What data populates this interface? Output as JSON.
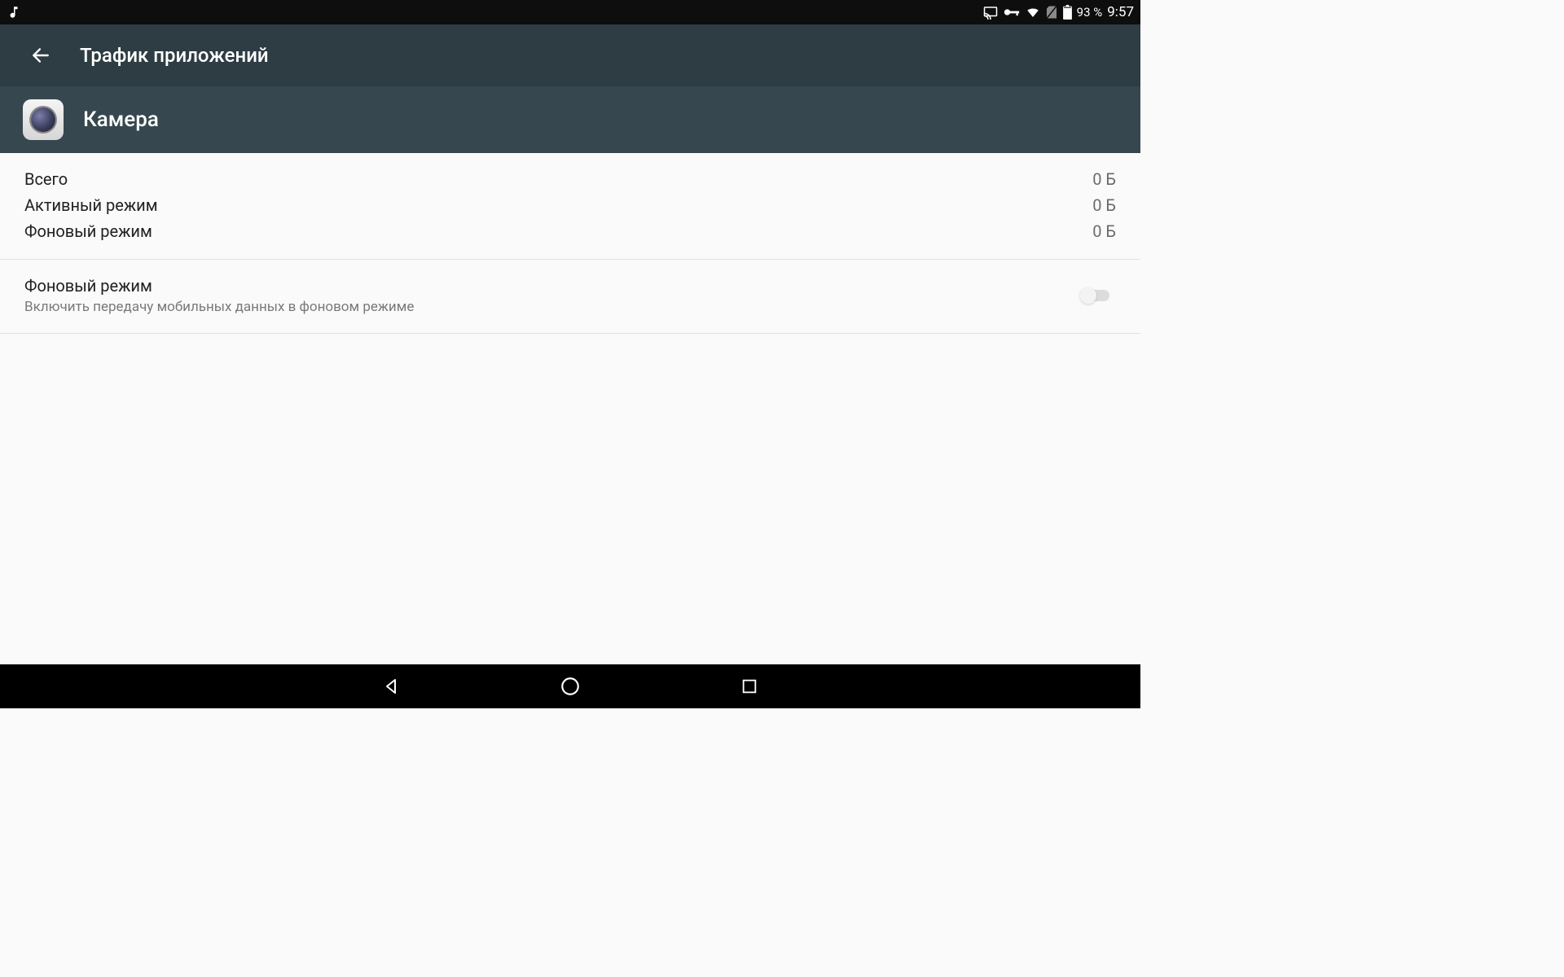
{
  "status": {
    "battery_pct": "93 %",
    "clock": "9:57"
  },
  "header": {
    "title": "Трафик приложений"
  },
  "app": {
    "name": "Камера"
  },
  "stats": {
    "total": {
      "label": "Всего",
      "value": "0 Б"
    },
    "foreground": {
      "label": "Активный режим",
      "value": "0 Б"
    },
    "background": {
      "label": "Фоновый режим",
      "value": "0 Б"
    }
  },
  "setting": {
    "title": "Фоновый режим",
    "subtitle": "Включить передачу мобильных данных в фоновом режиме"
  }
}
